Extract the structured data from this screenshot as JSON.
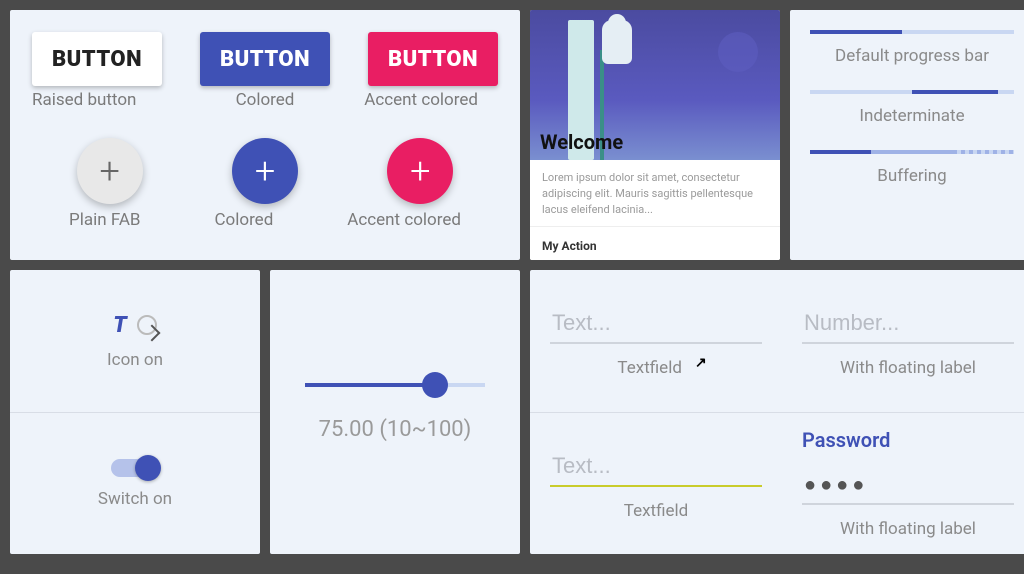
{
  "buttons": {
    "raised": {
      "label": "BUTTON",
      "caption": "Raised button"
    },
    "colored": {
      "label": "BUTTON",
      "caption": "Colored"
    },
    "accent": {
      "label": "BUTTON",
      "caption": "Accent colored"
    },
    "fab_plain": {
      "glyph": "+",
      "caption": "Plain FAB"
    },
    "fab_colored": {
      "glyph": "+",
      "caption": "Colored"
    },
    "fab_accent": {
      "glyph": "+",
      "caption": "Accent colored"
    }
  },
  "card": {
    "title": "Welcome",
    "body": "Lorem ipsum dolor sit amet, consectetur adipiscing elit. Mauris sagittis pellentesque lacus eleifend lacinia...",
    "action": "My Action"
  },
  "progress": {
    "p1": {
      "caption": "Default progress bar",
      "percent": 45
    },
    "p2": {
      "caption": "Indeterminate"
    },
    "p3": {
      "caption": "Buffering"
    }
  },
  "toggles": {
    "icon_letter": "T",
    "icon_caption": "Icon on",
    "switch_caption": "Switch on"
  },
  "slider": {
    "display": "75.00 (10~100)"
  },
  "textfields": {
    "tf1": {
      "placeholder": "Text...",
      "caption": "Textfield"
    },
    "tf2": {
      "placeholder": "Number...",
      "caption": "With floating label"
    },
    "tf3": {
      "placeholder": "Text...",
      "caption": "Textfield"
    },
    "tf4": {
      "float_label": "Password",
      "masked": "●●●●",
      "caption": "With floating label"
    }
  }
}
